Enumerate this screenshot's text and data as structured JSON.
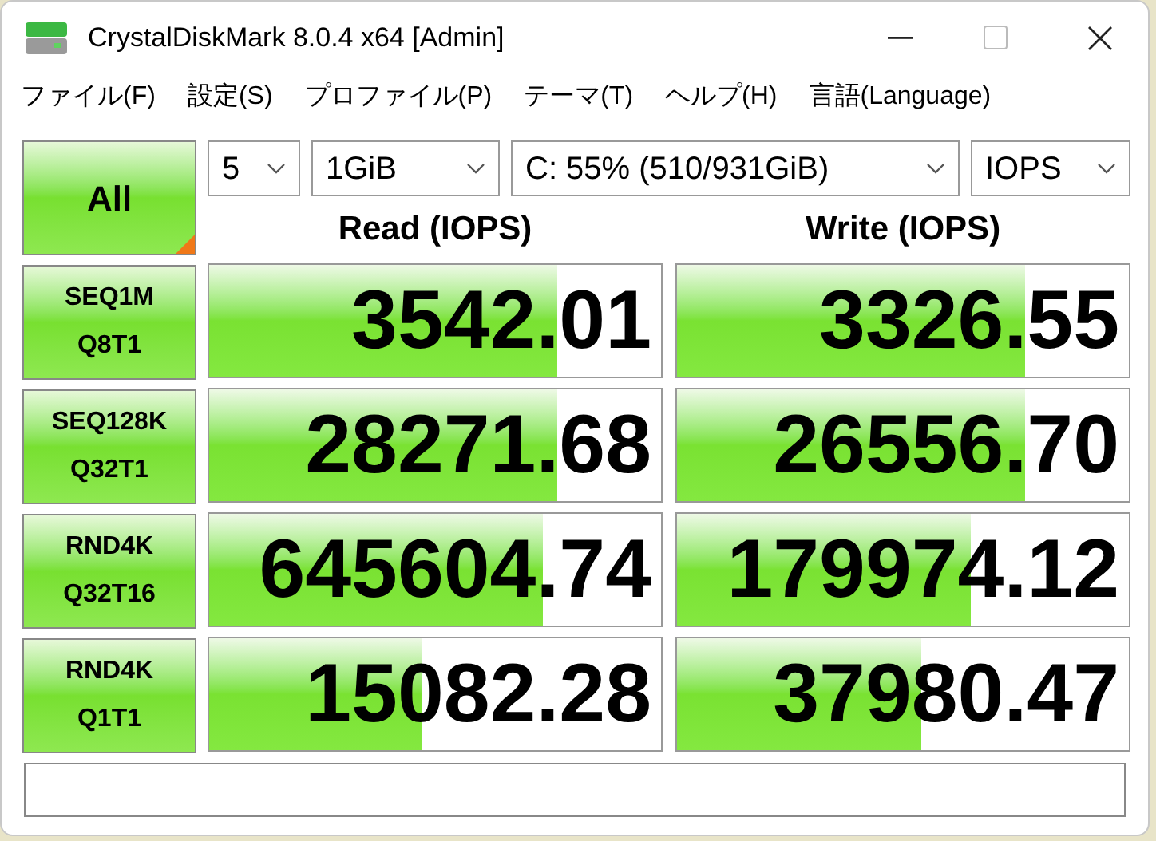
{
  "window": {
    "title": "CrystalDiskMark 8.0.4 x64 [Admin]"
  },
  "menu": [
    "ファイル(F)",
    "設定(S)",
    "プロファイル(P)",
    "テーマ(T)",
    "ヘルプ(H)",
    "言語(Language)"
  ],
  "all_button": "All",
  "selects": [
    {
      "value": "5"
    },
    {
      "value": "1GiB"
    },
    {
      "value": "C: 55% (510/931GiB)"
    },
    {
      "value": "IOPS"
    }
  ],
  "columns": [
    "Read (IOPS)",
    "Write (IOPS)"
  ],
  "rows": [
    {
      "line1": "SEQ1M",
      "line2": "Q8T1",
      "read": {
        "value": "3542.01",
        "level": 0.77
      },
      "write": {
        "value": "3326.55",
        "level": 0.77
      }
    },
    {
      "line1": "SEQ128K",
      "line2": "Q32T1",
      "read": {
        "value": "28271.68",
        "level": 0.77
      },
      "write": {
        "value": "26556.70",
        "level": 0.77
      }
    },
    {
      "line1": "RND4K",
      "line2": "Q32T16",
      "read": {
        "value": "645604.74",
        "level": 0.74
      },
      "write": {
        "value": "179974.12",
        "level": 0.65
      }
    },
    {
      "line1": "RND4K",
      "line2": "Q1T1",
      "read": {
        "value": "15082.28",
        "level": 0.47
      },
      "write": {
        "value": "37980.47",
        "level": 0.54
      }
    }
  ]
}
